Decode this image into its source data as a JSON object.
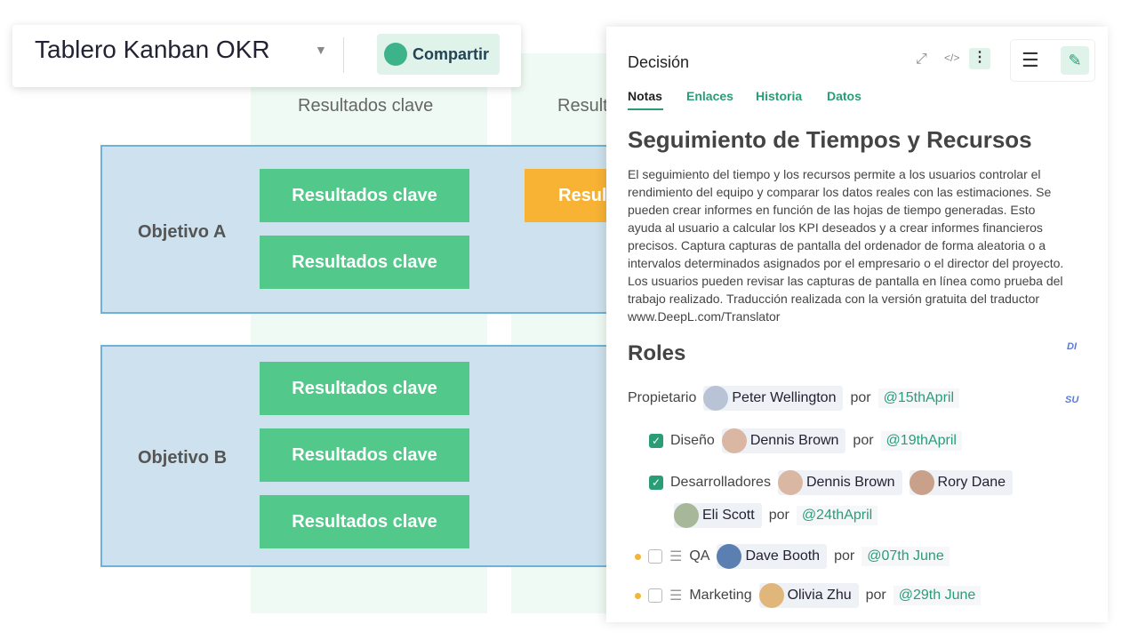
{
  "board": {
    "title": "Tablero Kanban OKR",
    "share": "Compartir",
    "column_header": "Resultados clave",
    "column_header_2": "Result",
    "objectives": [
      {
        "label": "Objetivo A",
        "cards": [
          "Resultados clave",
          "Resultados clave"
        ]
      },
      {
        "label": "Objetivo B",
        "cards": [
          "Resultados clave",
          "Resultados clave",
          "Resultados clave"
        ]
      }
    ],
    "orange_card": "Resul"
  },
  "panel": {
    "title": "Decisión",
    "tabs": [
      "Notas",
      "Enlaces",
      "Historia",
      "Datos"
    ],
    "heading": "Seguimiento de Tiempos y Recursos",
    "body": "El seguimiento del tiempo y los recursos permite a los usuarios controlar el rendimiento del equipo y comparar los datos reales con las estimaciones. Se pueden crear informes en función de las hojas de tiempo generadas. Esto ayuda al usuario a calcular los KPI deseados y a crear informes financieros precisos. Captura capturas de pantalla del ordenador de forma aleatoria o a intervalos determinados asignados por el empresario o el director del proyecto. Los usuarios pueden revisar las capturas de pantalla en línea como prueba del trabajo realizado. Traducción realizada con la versión gratuita del traductor www.DeepL.com/Translator",
    "roles_heading": "Roles",
    "tag_di": "DI",
    "tag_su": "SU",
    "por": "por",
    "owner": {
      "label": "Propietario",
      "person": "Peter Wellington",
      "date": "@15thApril"
    },
    "design": {
      "label": "Diseño",
      "person": "Dennis Brown",
      "date": "@19thApril"
    },
    "dev": {
      "label": "Desarrolladores",
      "people": [
        "Dennis Brown",
        "Rory Dane",
        "Eli Scott"
      ],
      "date": "@24thApril"
    },
    "qa": {
      "label": "QA",
      "person": "Dave Booth",
      "date": "@07th June"
    },
    "marketing": {
      "label": "Marketing",
      "person": "Olivia Zhu",
      "date": "@29th June"
    }
  },
  "colors": {
    "accent": "#2a9d78",
    "card": "#52c98a",
    "orange": "#f8b334"
  }
}
